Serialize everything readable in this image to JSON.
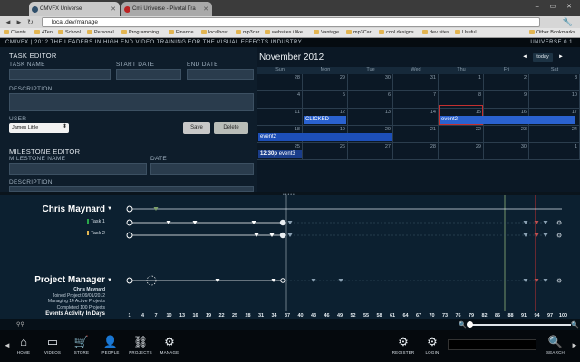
{
  "browser": {
    "tabs": [
      {
        "label": "CMVFX Universe",
        "active": true
      },
      {
        "label": "Cmi Universe - Pivotal Tra",
        "active": false
      }
    ],
    "window_controls": "– ▭ ✕",
    "url": "local.dev/manage",
    "bookmarks": [
      "Clients",
      "4Ten",
      "School",
      "Personal",
      "Programming",
      "Finance",
      "localhost",
      "mp3car",
      "websites i like",
      "Vantage",
      "mp3Car",
      "cool designs",
      "dev sites",
      "Useful",
      "Other Bookmarks"
    ]
  },
  "app_header": {
    "brand": "CMIVFX | 2012  THE LEADERS IN HIGH END VIDEO TRAINING FOR THE VISUAL EFFECTS INDUSTRY",
    "version": "UNIVERSE 0.1"
  },
  "task_editor": {
    "title": "TASK EDITOR",
    "task_name_label": "TASK NAME",
    "start_date_label": "START DATE",
    "end_date_label": "END DATE",
    "description_label": "DESCRIPTION",
    "user_label": "USER",
    "user_value": "James Little",
    "save_label": "Save",
    "delete_label": "Delete"
  },
  "milestone_editor": {
    "title": "MILESTONE EDITOR",
    "name_label": "MILESTONE NAME",
    "date_label": "DATE",
    "description_label": "DESCRIPTION"
  },
  "calendar": {
    "title": "November 2012",
    "prev": "◄",
    "next": "►",
    "today_label": "today",
    "days_of_week": [
      "Sun",
      "Mon",
      "Tue",
      "Wed",
      "Thu",
      "Fri",
      "Sat"
    ],
    "weeks": [
      [
        "28",
        "29",
        "30",
        "31",
        "1",
        "2",
        "3"
      ],
      [
        "4",
        "5",
        "6",
        "7",
        "8",
        "9",
        "10"
      ],
      [
        "11",
        "12",
        "13",
        "14",
        "15",
        "16",
        "17"
      ],
      [
        "18",
        "19",
        "20",
        "21",
        "22",
        "23",
        "24"
      ],
      [
        "25",
        "26",
        "27",
        "28",
        "29",
        "30",
        "1"
      ]
    ],
    "events": {
      "clicked": "CLICKED",
      "event2_a": "event2",
      "event2_b": "event2",
      "event3_time": "12:30p",
      "event3_name": "event3"
    }
  },
  "timeline": {
    "people": [
      {
        "name": "Chris Maynard",
        "tasks": [
          "Task 1",
          "Task 2"
        ]
      },
      {
        "name": "Project Manager",
        "info": [
          "Chris Maynard",
          "Joined Project 09/01/2012",
          "Managing 14 Active Projects",
          "Completed 100 Projects"
        ]
      }
    ],
    "axis_title": "Events Activity In Days",
    "ticks": [
      "1",
      "4",
      "7",
      "10",
      "13",
      "16",
      "19",
      "22",
      "25",
      "28",
      "31",
      "34",
      "37",
      "40",
      "43",
      "46",
      "49",
      "52",
      "55",
      "58",
      "61",
      "64",
      "67",
      "70",
      "73",
      "76",
      "79",
      "82",
      "85",
      "88",
      "91",
      "94",
      "97",
      "100"
    ],
    "colors": {
      "task1": "#2aa84a",
      "task2": "#e2b552",
      "today_line": "#c43030",
      "milestone": "#7ea06a"
    }
  },
  "bottom_nav": {
    "items": [
      {
        "label": "HOME",
        "icon": "home-icon"
      },
      {
        "label": "VIDEOS",
        "icon": "monitor-icon"
      },
      {
        "label": "STORE",
        "icon": "cart-icon"
      },
      {
        "label": "PEOPLE",
        "icon": "person-icon"
      },
      {
        "label": "PROJECTS",
        "icon": "network-icon"
      },
      {
        "label": "MANAGE",
        "icon": "gear-icon"
      }
    ],
    "right_items": [
      {
        "label": "REGISTER",
        "icon": "gear-icon"
      },
      {
        "label": "LOGIN",
        "icon": "gear-icon"
      },
      {
        "label": "SEARCH",
        "icon": "search-icon"
      }
    ]
  }
}
